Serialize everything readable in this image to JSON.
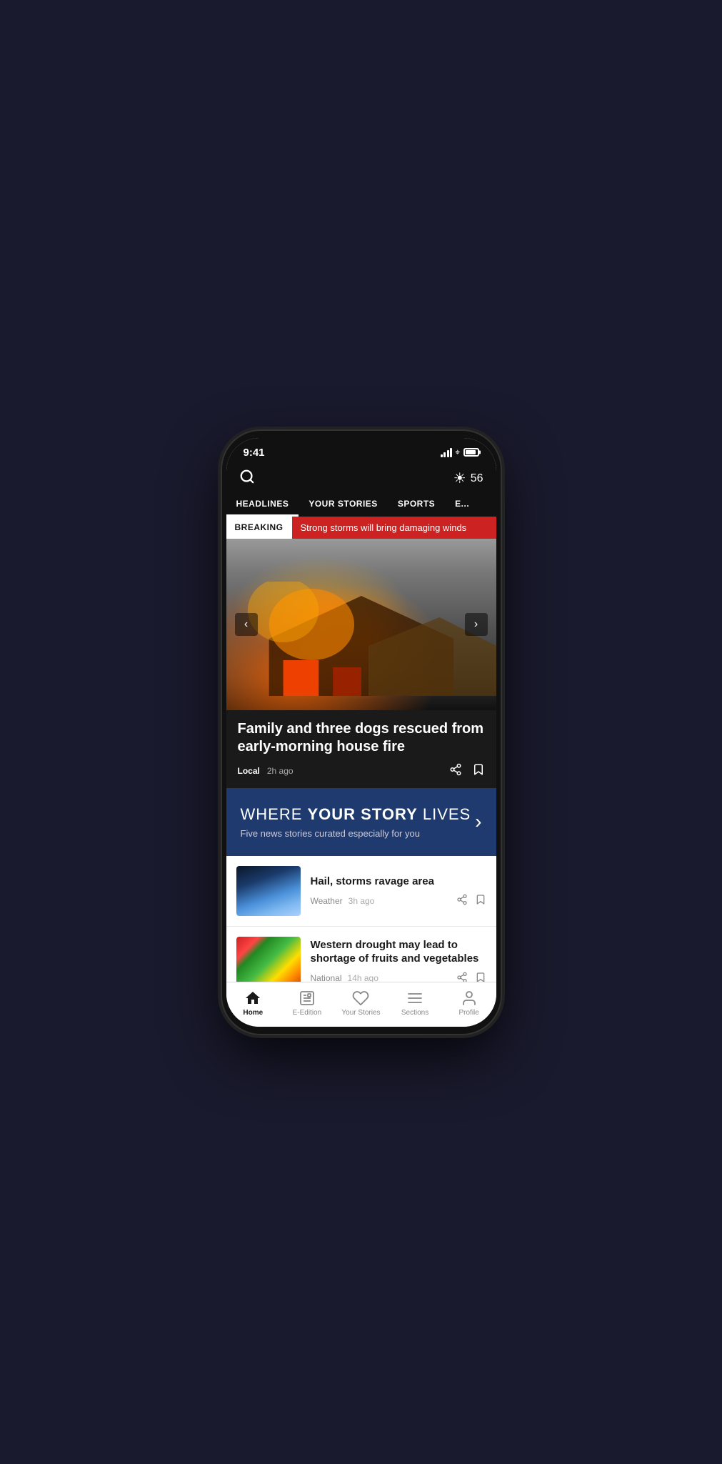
{
  "status_bar": {
    "time": "9:41",
    "temperature": "56",
    "temperature_unit": "°"
  },
  "nav_tabs": {
    "items": [
      {
        "label": "HEADLINES",
        "active": true
      },
      {
        "label": "YOUR STORIES",
        "active": false
      },
      {
        "label": "SPORTS",
        "active": false
      },
      {
        "label": "E",
        "active": false
      }
    ]
  },
  "breaking_bar": {
    "label": "BREAKING",
    "text": "Strong storms will bring damaging winds"
  },
  "hero": {
    "headline": "Family and three dogs rescued from early-morning house fire",
    "category": "Local",
    "time_ago": "2h ago"
  },
  "promo_banner": {
    "title_part1": "WHERE ",
    "title_bold": "YOUR STORY",
    "title_part2": " LIVES",
    "subtitle": "Five news stories curated especially for you"
  },
  "news_items": [
    {
      "headline": "Hail, storms ravage area",
      "category": "Weather",
      "time_ago": "3h ago",
      "thumb_type": "storm"
    },
    {
      "headline": "Western drought may lead to shortage of fruits and vegetables",
      "category": "National",
      "time_ago": "14h ago",
      "thumb_type": "veggies"
    }
  ],
  "bottom_nav": {
    "items": [
      {
        "label": "Home",
        "icon": "home",
        "active": true
      },
      {
        "label": "E-Edition",
        "icon": "edition",
        "active": false
      },
      {
        "label": "Your Stories",
        "icon": "heart",
        "active": false
      },
      {
        "label": "Sections",
        "icon": "sections",
        "active": false
      },
      {
        "label": "Profile",
        "icon": "profile",
        "active": false
      }
    ]
  }
}
